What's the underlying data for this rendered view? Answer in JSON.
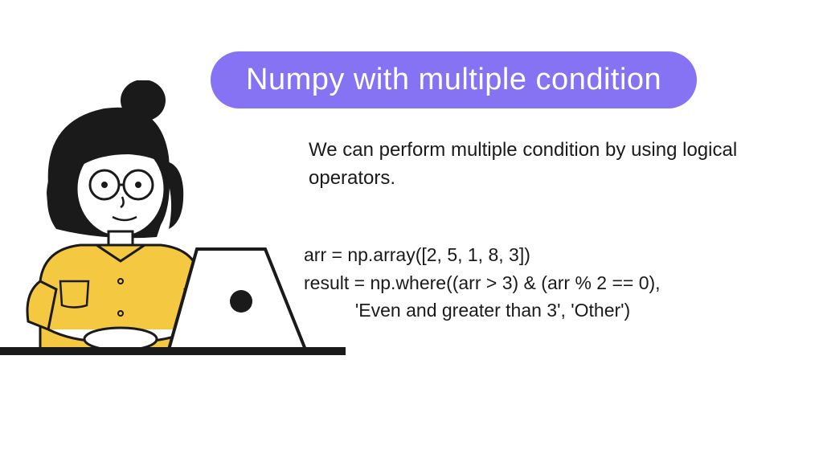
{
  "title": "Numpy with multiple condition",
  "description": "We can perform multiple condition by\nusing logical operators.",
  "code": {
    "line1": "arr = np.array([2, 5, 1, 8, 3])",
    "line2": "result = np.where((arr > 3) & (arr % 2 == 0),",
    "line3": "          'Even and greater than 3', 'Other')"
  }
}
